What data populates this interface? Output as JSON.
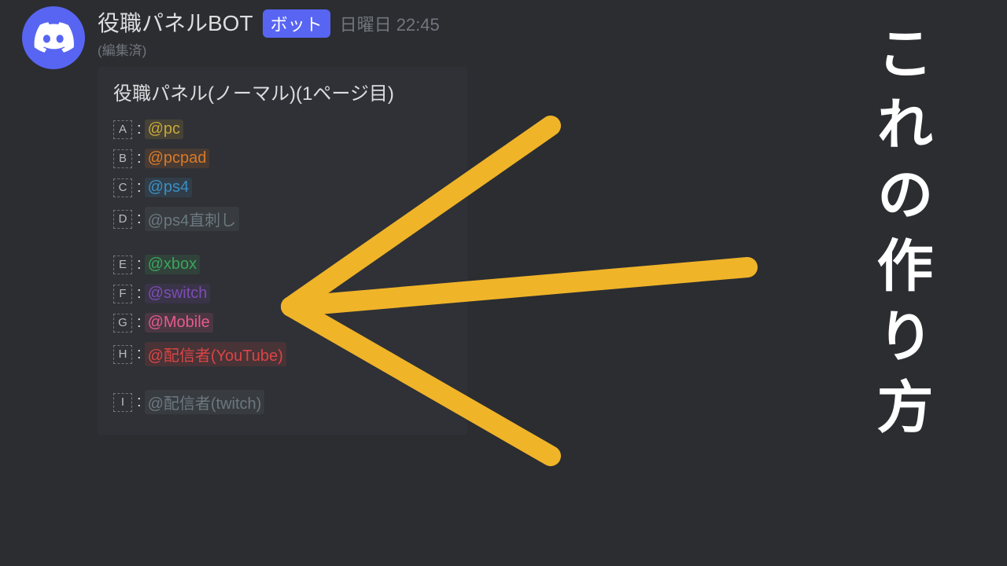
{
  "message": {
    "username": "役職パネルBOT",
    "bot_badge": "ボット",
    "timestamp": "日曜日 22:45",
    "edited": "(編集済)"
  },
  "embed": {
    "title": "役職パネル(ノーマル)(1ページ目)"
  },
  "roles": [
    {
      "letter": "A",
      "label": "@pc",
      "color": "#c7a83a",
      "bg": "rgba(199,168,58,0.15)"
    },
    {
      "letter": "B",
      "label": "@pcpad",
      "color": "#d97a2b",
      "bg": "rgba(217,122,43,0.15)"
    },
    {
      "letter": "C",
      "label": "@ps4",
      "color": "#3a8fc2",
      "bg": "rgba(58,143,194,0.15)"
    },
    {
      "letter": "D",
      "label": "@ps4直刺し",
      "color": "#6b787f",
      "bg": "rgba(107,120,127,0.15)"
    },
    {
      "letter": "E",
      "label": "@xbox",
      "color": "#3ba55c",
      "bg": "rgba(59,165,92,0.15)"
    },
    {
      "letter": "F",
      "label": "@switch",
      "color": "#7b4db3",
      "bg": "rgba(123,77,179,0.15)"
    },
    {
      "letter": "G",
      "label": "@Mobile",
      "color": "#e55b8e",
      "bg": "rgba(229,91,142,0.15)"
    },
    {
      "letter": "H",
      "label": "@配信者(YouTube)",
      "color": "#d94545",
      "bg": "rgba(217,69,69,0.15)"
    },
    {
      "letter": "I",
      "label": "@配信者(twitch)",
      "color": "#6b787f",
      "bg": "rgba(107,120,127,0.15)"
    }
  ],
  "overlay": {
    "vertical_text": "これの作り方"
  }
}
